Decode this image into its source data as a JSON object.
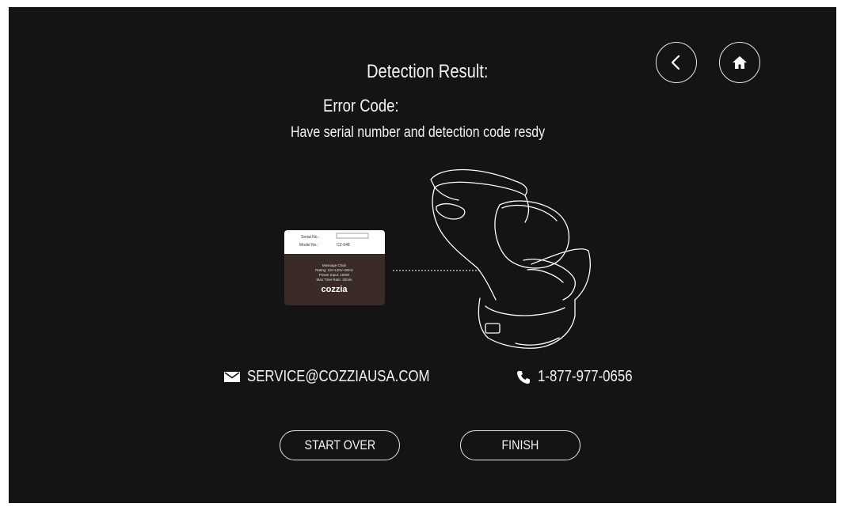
{
  "nav": {
    "back_icon": "chevron-left-icon",
    "home_icon": "home-icon"
  },
  "header": {
    "title": "Detection Result:",
    "error_code_label": "Error Code:",
    "instruction": "Have serial number and detection code resdy"
  },
  "label_card": {
    "serial_label": "Serial No.:",
    "model_label": "Model No.:",
    "model_value": "CZ-648",
    "product": "Massage Chair",
    "rating": "Rating: 110-120V~60Hz",
    "power": "Power Input: 165W",
    "max_time": "Max Time Rate: 30min",
    "brand": "cozzia"
  },
  "contact": {
    "email": "SERVICE@COZZIAUSA.COM",
    "phone": "1-877-977-0656"
  },
  "actions": {
    "start_over": "START OVER",
    "finish": "FINISH"
  },
  "colors": {
    "background": "#141414",
    "foreground": "#ffffff",
    "label_dark": "#3a2b28"
  }
}
